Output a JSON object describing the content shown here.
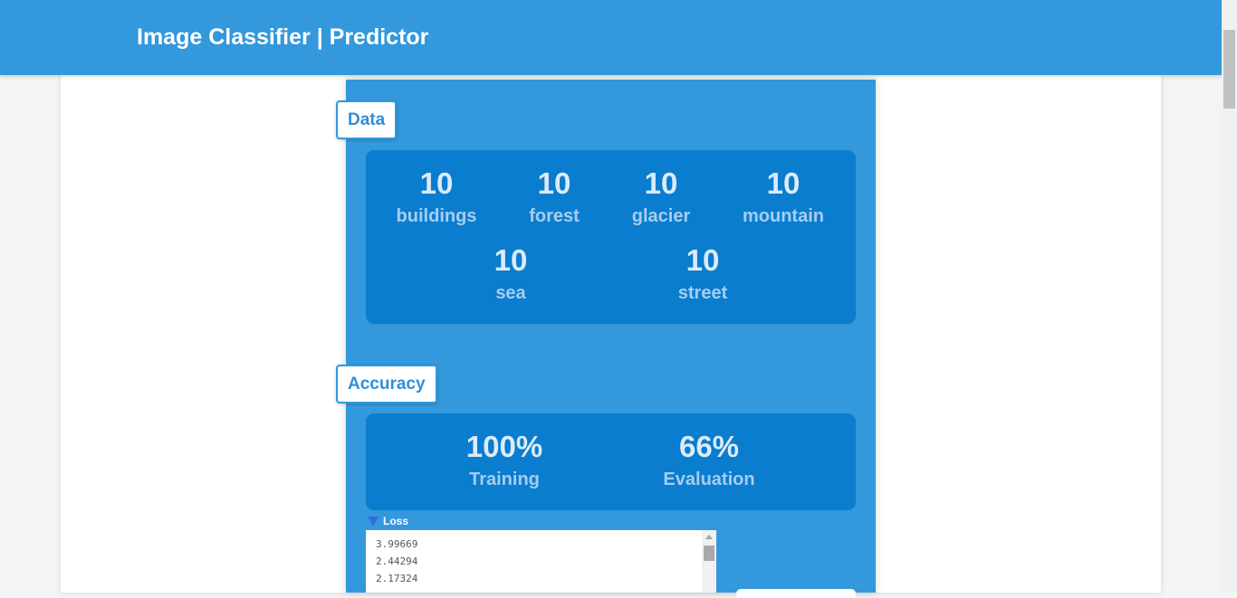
{
  "header": {
    "title": "Image Classifier | Predictor"
  },
  "sections": {
    "data_tag": "Data",
    "accuracy_tag": "Accuracy"
  },
  "data_counts": [
    {
      "value": "10",
      "label": "buildings"
    },
    {
      "value": "10",
      "label": "forest"
    },
    {
      "value": "10",
      "label": "glacier"
    },
    {
      "value": "10",
      "label": "mountain"
    },
    {
      "value": "10",
      "label": "sea"
    },
    {
      "value": "10",
      "label": "street"
    }
  ],
  "accuracy": [
    {
      "value": "100%",
      "label": "Training"
    },
    {
      "value": "66%",
      "label": "Evaluation"
    }
  ],
  "loss": {
    "title": "Loss",
    "values": [
      "3.99669",
      "2.44294",
      "2.17324"
    ]
  },
  "colors": {
    "header_bg": "#3398dc",
    "panel_bg": "#3398dc",
    "card_bg": "#0a7dcf",
    "value_text": "#dcebf8",
    "label_text": "#a7cdef",
    "tag_text": "#2f8fd6"
  }
}
